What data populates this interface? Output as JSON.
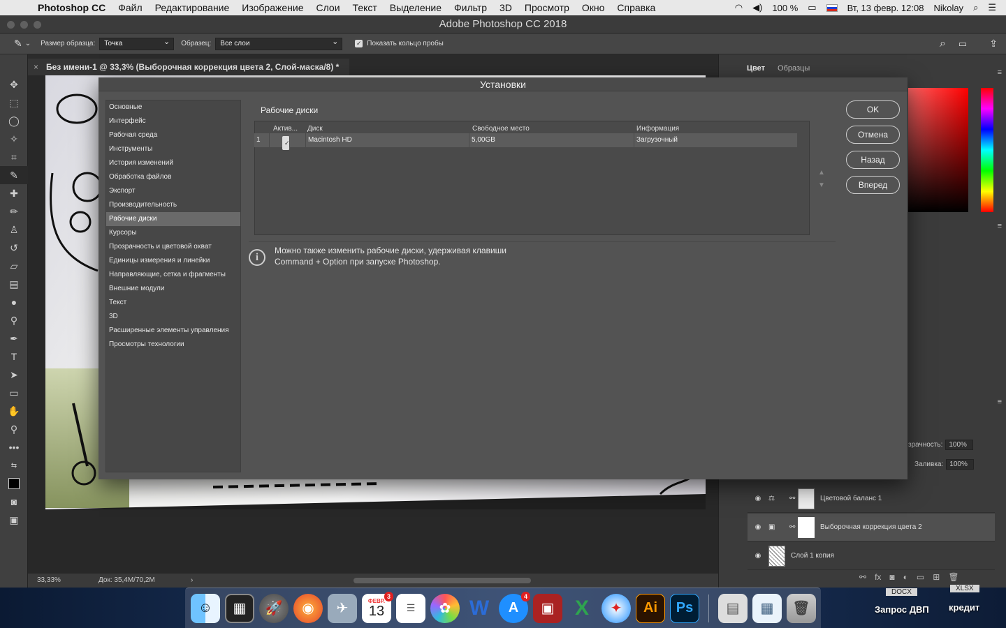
{
  "menubar": {
    "app": "Photoshop CC",
    "items": [
      "Файл",
      "Редактирование",
      "Изображение",
      "Слои",
      "Текст",
      "Выделение",
      "Фильтр",
      "3D",
      "Просмотр",
      "Окно",
      "Справка"
    ],
    "battery": "100 %",
    "clock": "Вт, 13 февр.  12:08",
    "user": "Nikolay"
  },
  "window_title": "Adobe Photoshop CC 2018",
  "options": {
    "sample_size_label": "Размер образца:",
    "sample_size_value": "Точка",
    "sample_label": "Образец:",
    "sample_value": "Все слои",
    "show_ring_label": "Показать кольцо пробы"
  },
  "document": {
    "tab_title": "Без имени-1 @ 33,3% (Выборочная коррекция цвета 2, Слой-маска/8) *",
    "zoom": "33,33%",
    "doc_size": "Док: 35,4M/70,2M"
  },
  "panels": {
    "color_tab": "Цвет",
    "swatches_tab": "Образцы",
    "opacity_label": "зрачность:",
    "opacity_value": "100%",
    "fill_label": "Заливка:",
    "fill_value": "100%",
    "layers": [
      {
        "name": "Цветовой баланс 1",
        "selected": false
      },
      {
        "name": "Выборочная коррекция цвета 2",
        "selected": true
      },
      {
        "name": "Слой 1 копия",
        "selected": false
      }
    ]
  },
  "dialog": {
    "title": "Установки",
    "nav": [
      "Основные",
      "Интерфейс",
      "Рабочая среда",
      "Инструменты",
      "История изменений",
      "Обработка файлов",
      "Экспорт",
      "Производительность",
      "Рабочие диски",
      "Курсоры",
      "Прозрачность и цветовой охват",
      "Единицы измерения и линейки",
      "Направляющие, сетка и фрагменты",
      "Внешние модули",
      "Текст",
      "3D",
      "Расширенные элементы управления",
      "Просмотры технологии"
    ],
    "active_nav": 8,
    "section_title": "Рабочие диски",
    "table": {
      "headers": [
        "Актив...",
        "Диск",
        "Свободное место",
        "Информация"
      ],
      "rows": [
        {
          "index": "1",
          "active": true,
          "disk": "Macintosh HD",
          "free": "5,00GB",
          "info": "Загрузочный"
        }
      ]
    },
    "info_line1": "Можно также изменить рабочие диски, удерживая клавиши",
    "info_line2": "Command + Option при запуске Photoshop.",
    "buttons": {
      "ok": "OK",
      "cancel": "Отмена",
      "back": "Назад",
      "forward": "Вперед"
    }
  },
  "dock": {
    "calendar_month": "ФЕВР.",
    "calendar_day": "13",
    "calendar_badge": "3",
    "appstore_badge": "4",
    "illustrator": "Ai",
    "photoshop": "Ps"
  },
  "desktop": {
    "file1_type": "DOCX",
    "file1": "Запрос ДВП",
    "file2_type": "XLSX",
    "file2": "кредит"
  }
}
